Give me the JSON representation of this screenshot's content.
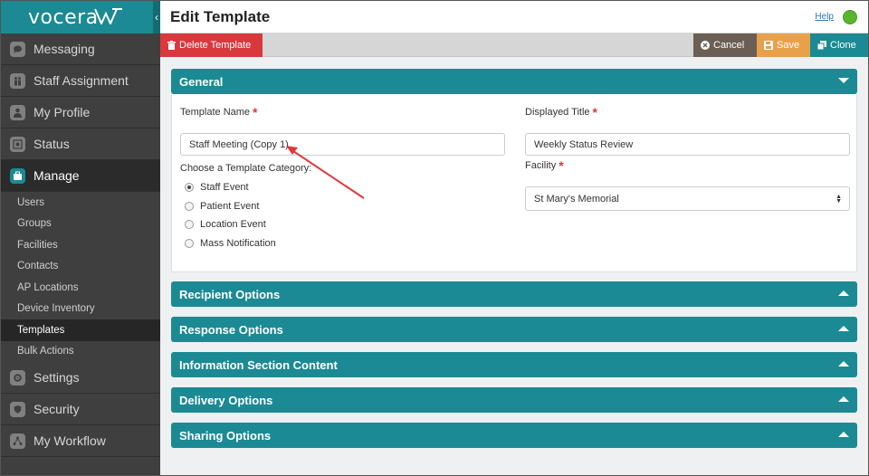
{
  "brand": {
    "logo_text": "vocera",
    "accent": "#1b8a94"
  },
  "sidebar": {
    "items": [
      {
        "label": "Messaging",
        "icon": "chat-bubble-icon"
      },
      {
        "label": "Staff Assignment",
        "icon": "people-icon"
      },
      {
        "label": "My Profile",
        "icon": "person-icon"
      },
      {
        "label": "Status",
        "icon": "status-icon"
      },
      {
        "label": "Manage",
        "icon": "briefcase-icon",
        "active": true
      }
    ],
    "manage_subitems": [
      {
        "label": "Users"
      },
      {
        "label": "Groups"
      },
      {
        "label": "Facilities"
      },
      {
        "label": "Contacts"
      },
      {
        "label": "AP Locations"
      },
      {
        "label": "Device Inventory"
      },
      {
        "label": "Templates",
        "active": true
      },
      {
        "label": "Bulk Actions"
      }
    ],
    "bottom_items": [
      {
        "label": "Settings",
        "icon": "gear-icon"
      },
      {
        "label": "Security",
        "icon": "shield-icon"
      },
      {
        "label": "My Workflow",
        "icon": "workflow-icon"
      }
    ]
  },
  "header": {
    "title": "Edit Template",
    "help_label": "Help",
    "status_color": "#5ab52e"
  },
  "toolbar": {
    "delete_label": "Delete Template",
    "cancel_label": "Cancel",
    "save_label": "Save",
    "clone_label": "Clone"
  },
  "general": {
    "title": "General",
    "template_name_label": "Template Name",
    "template_name_value": "Staff Meeting (Copy 1)",
    "displayed_title_label": "Displayed Title",
    "displayed_title_value": "Weekly Status Review",
    "category_label": "Choose a Template Category:",
    "categories": [
      {
        "label": "Staff Event",
        "checked": true
      },
      {
        "label": "Patient Event",
        "checked": false
      },
      {
        "label": "Location Event",
        "checked": false
      },
      {
        "label": "Mass Notification",
        "checked": false
      }
    ],
    "facility_label": "Facility",
    "facility_value": "St Mary's Memorial"
  },
  "sections": [
    {
      "title": "Recipient Options"
    },
    {
      "title": "Response Options"
    },
    {
      "title": "Information Section Content"
    },
    {
      "title": "Delivery Options"
    },
    {
      "title": "Sharing Options"
    }
  ]
}
